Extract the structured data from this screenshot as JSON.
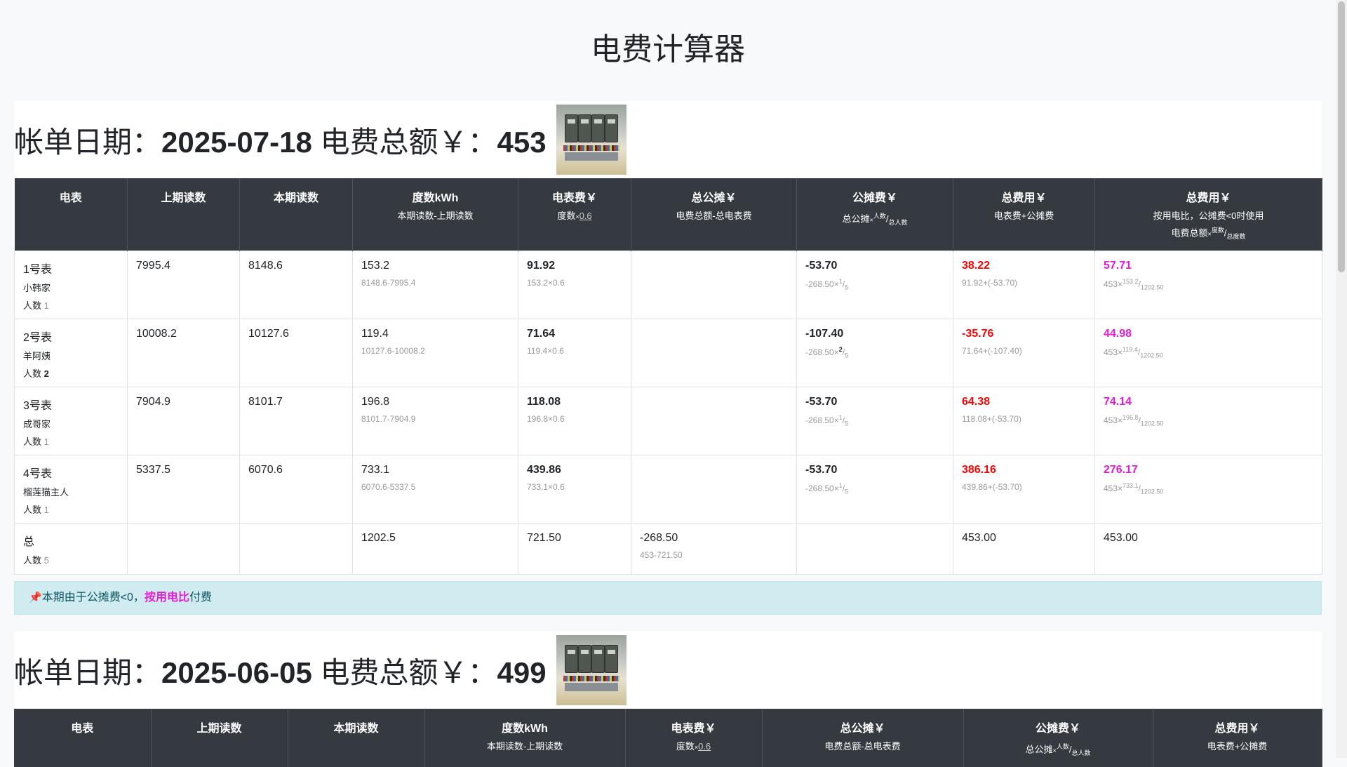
{
  "app_title": "电费计算器",
  "headers_full": [
    {
      "title": "电表",
      "sub": ""
    },
    {
      "title": "上期读数",
      "sub": ""
    },
    {
      "title": "本期读数",
      "sub": ""
    },
    {
      "title": "度数kWh",
      "sub": "本期读数-上期读数"
    },
    {
      "title": "电表费￥",
      "sub_a": "度数",
      "sub_x": "×",
      "sub_b": "0.6"
    },
    {
      "title": "总公摊￥",
      "sub": "电费总额-总电表费"
    },
    {
      "title": "公摊费￥",
      "sub_a": "总公摊",
      "sub_x": "×",
      "sup": "人数",
      "sub_sep": "/",
      "sub_den": "总人数"
    },
    {
      "title": "总费用￥",
      "sub": "电表费+公摊费"
    },
    {
      "title": "总费用￥",
      "sub_line1": "按用电比，公摊费<0时使用",
      "sub_a": "电费总额",
      "sub_x": "×",
      "sup": "度数",
      "sub_sep": "/",
      "sub_den": "总度数"
    }
  ],
  "bills": [
    {
      "date_label": "帐单日期：",
      "date": "2025-07-18",
      "total_label": " 电费总额￥：",
      "total": "453",
      "rows": [
        {
          "meter": "1号表",
          "owner": "小韩家",
          "people_label": "人数",
          "people": "1",
          "prev": "7995.4",
          "curr": "8148.6",
          "kwh": "153.2",
          "kwh_f": "8148.6-7995.4",
          "fee": "91.92",
          "fee_f": "153.2×0.6",
          "share": "-53.70",
          "share_f_a": "-268.50×",
          "share_f_sup": "1",
          "share_f_den": "5",
          "total": "38.22",
          "total_f": "91.92+(-53.70)",
          "ratio": "57.71",
          "ratio_f_a": "453×",
          "ratio_f_sup": "153.2",
          "ratio_f_den": "1202.50"
        },
        {
          "meter": "2号表",
          "owner": "羊阿姨",
          "people_label": "人数",
          "people": "2",
          "prev": "10008.2",
          "curr": "10127.6",
          "kwh": "119.4",
          "kwh_f": "10127.6-10008.2",
          "fee": "71.64",
          "fee_f": "119.4×0.6",
          "share": "-107.40",
          "share_f_a": "-268.50×",
          "share_f_sup": "2",
          "share_f_den": "5",
          "total": "-35.76",
          "total_f": "71.64+(-107.40)",
          "ratio": "44.98",
          "ratio_f_a": "453×",
          "ratio_f_sup": "119.4",
          "ratio_f_den": "1202.50"
        },
        {
          "meter": "3号表",
          "owner": "成哥家",
          "people_label": "人数",
          "people": "1",
          "prev": "7904.9",
          "curr": "8101.7",
          "kwh": "196.8",
          "kwh_f": "8101.7-7904.9",
          "fee": "118.08",
          "fee_f": "196.8×0.6",
          "share": "-53.70",
          "share_f_a": "-268.50×",
          "share_f_sup": "1",
          "share_f_den": "5",
          "total": "64.38",
          "total_f": "118.08+(-53.70)",
          "ratio": "74.14",
          "ratio_f_a": "453×",
          "ratio_f_sup": "196.8",
          "ratio_f_den": "1202.50"
        },
        {
          "meter": "4号表",
          "owner": "榴莲猫主人",
          "people_label": "人数",
          "people": "1",
          "prev": "5337.5",
          "curr": "6070.6",
          "kwh": "733.1",
          "kwh_f": "6070.6-5337.5",
          "fee": "439.86",
          "fee_f": "733.1×0.6",
          "share": "-53.70",
          "share_f_a": "-268.50×",
          "share_f_sup": "1",
          "share_f_den": "5",
          "total": "386.16",
          "total_f": "439.86+(-53.70)",
          "ratio": "276.17",
          "ratio_f_a": "453×",
          "ratio_f_sup": "733.1",
          "ratio_f_den": "1202.50"
        }
      ],
      "totals": {
        "label": "总",
        "people_label": "人数",
        "people": "5",
        "kwh": "1202.5",
        "fee": "721.50",
        "pool": "-268.50",
        "pool_f": "453-721.50",
        "total": "453.00",
        "ratio": "453.00"
      },
      "note": {
        "icon": "📌",
        "pre": "本期由于公摊费<0，",
        "hl": "按用电比",
        "post": "付费"
      }
    },
    {
      "date_label": "帐单日期：",
      "date": "2025-06-05",
      "total_label": " 电费总额￥：",
      "total": "499"
    }
  ]
}
